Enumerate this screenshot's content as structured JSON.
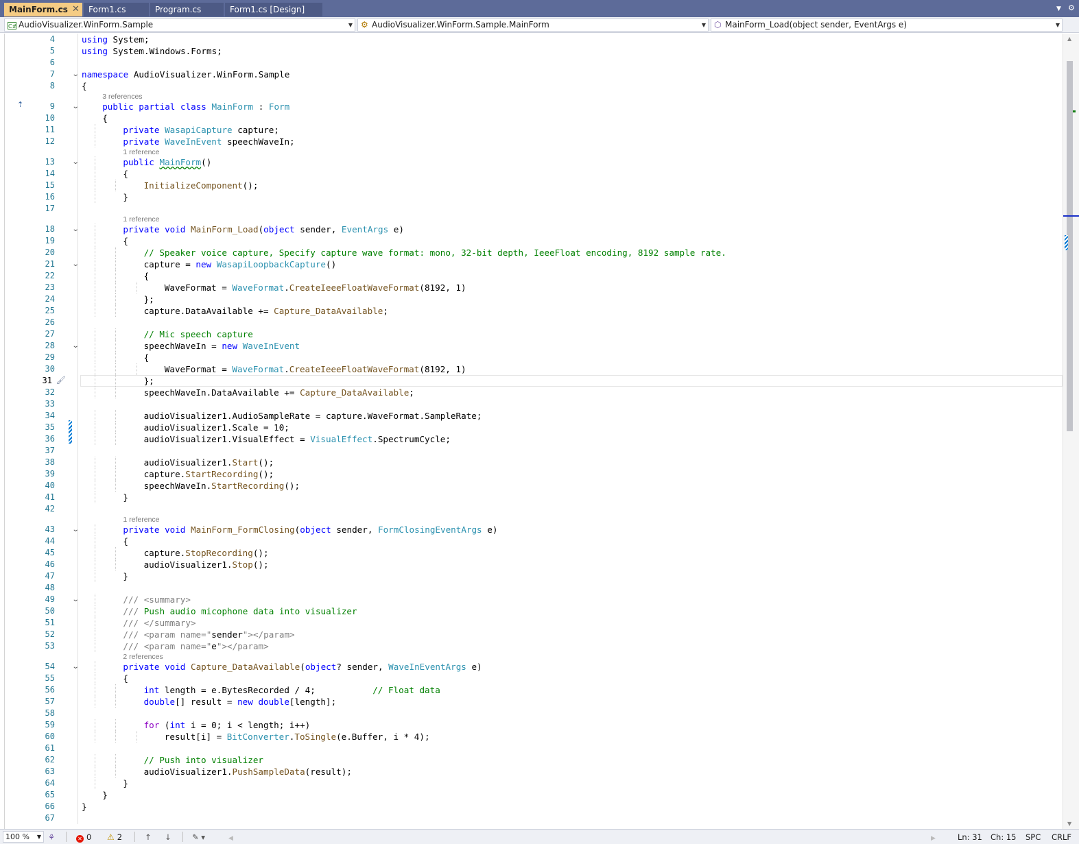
{
  "tabs": [
    {
      "label": "MainForm.cs",
      "active": true,
      "pin_icon": "pin-icon",
      "close_icon": "close-icon"
    },
    {
      "label": "Form1.cs",
      "active": false
    },
    {
      "label": "Program.cs",
      "active": false
    },
    {
      "label": "Form1.cs [Design]",
      "active": false
    }
  ],
  "nav": {
    "project": "AudioVisualizer.WinForm.Sample",
    "type": "AudioVisualizer.WinForm.Sample.MainForm",
    "member": "MainForm_Load(object sender, EventArgs e)"
  },
  "colors": {
    "keyword": "#0000ff",
    "type": "#2b91af",
    "method": "#74531f",
    "comment": "#008000",
    "line_number": "#237893",
    "tab_active": "#f5cc84",
    "tab_bar": "#5d6b99"
  },
  "current_line": 31,
  "code_lines": [
    {
      "n": 4,
      "indent": 0,
      "parts": [
        [
          "k",
          "using"
        ],
        [
          "",
          "System;"
        ]
      ],
      "guides": 0
    },
    {
      "n": 5,
      "indent": 0,
      "parts": [
        [
          "k",
          "using"
        ],
        [
          "",
          "System.Windows.Forms;"
        ]
      ]
    },
    {
      "n": 6,
      "indent": 0,
      "parts": []
    },
    {
      "n": 7,
      "indent": 0,
      "fold": true,
      "parts": [
        [
          "k",
          "namespace"
        ],
        [
          "",
          " AudioVisualizer.WinForm.Sample"
        ]
      ]
    },
    {
      "n": 8,
      "indent": 0,
      "parts": [
        [
          "",
          "{"
        ]
      ]
    },
    {
      "n": 9,
      "indent": 1,
      "fold": true,
      "lens": "3 references",
      "parts": [
        [
          "k",
          "public"
        ],
        [
          "",
          " "
        ],
        [
          "k",
          "partial"
        ],
        [
          "",
          " "
        ],
        [
          "k",
          "class"
        ],
        [
          "",
          " "
        ],
        [
          "t",
          "MainForm"
        ],
        [
          "",
          " : "
        ],
        [
          "t",
          "Form"
        ]
      ]
    },
    {
      "n": 10,
      "indent": 1,
      "parts": [
        [
          "",
          "{"
        ]
      ]
    },
    {
      "n": 11,
      "indent": 2,
      "parts": [
        [
          "k",
          "private"
        ],
        [
          "",
          " "
        ],
        [
          "t",
          "WasapiCapture"
        ],
        [
          "",
          " capture;"
        ]
      ]
    },
    {
      "n": 12,
      "indent": 2,
      "parts": [
        [
          "k",
          "private"
        ],
        [
          "",
          " "
        ],
        [
          "t",
          "WaveInEvent"
        ],
        [
          "",
          " speechWaveIn;"
        ]
      ]
    },
    {
      "n": 13,
      "indent": 2,
      "fold": true,
      "lens": "1 reference",
      "parts": [
        [
          "k",
          "public"
        ],
        [
          "",
          " "
        ],
        [
          "tsq",
          "MainForm"
        ],
        [
          "",
          "()"
        ]
      ]
    },
    {
      "n": 14,
      "indent": 2,
      "parts": [
        [
          "",
          "{"
        ]
      ]
    },
    {
      "n": 15,
      "indent": 3,
      "parts": [
        [
          "m",
          "InitializeComponent"
        ],
        [
          "",
          "();"
        ]
      ]
    },
    {
      "n": 16,
      "indent": 2,
      "parts": [
        [
          "",
          "}"
        ]
      ]
    },
    {
      "n": 17,
      "indent": 0,
      "parts": []
    },
    {
      "n": 18,
      "indent": 2,
      "fold": true,
      "lens": "1 reference",
      "parts": [
        [
          "k",
          "private"
        ],
        [
          "",
          " "
        ],
        [
          "k",
          "void"
        ],
        [
          "",
          " "
        ],
        [
          "m",
          "MainForm_Load"
        ],
        [
          "",
          "("
        ],
        [
          "k",
          "object"
        ],
        [
          "",
          " sender, "
        ],
        [
          "t",
          "EventArgs"
        ],
        [
          "",
          " e)"
        ]
      ]
    },
    {
      "n": 19,
      "indent": 2,
      "parts": [
        [
          "",
          "{"
        ]
      ]
    },
    {
      "n": 20,
      "indent": 3,
      "parts": [
        [
          "c",
          "// Speaker voice capture, Specify capture wave format: mono, 32-bit depth, IeeeFloat encoding, 8192 sample rate."
        ]
      ]
    },
    {
      "n": 21,
      "indent": 3,
      "fold": true,
      "parts": [
        [
          "",
          "capture = "
        ],
        [
          "k",
          "new"
        ],
        [
          "",
          " "
        ],
        [
          "t",
          "WasapiLoopbackCapture"
        ],
        [
          "",
          "()"
        ]
      ]
    },
    {
      "n": 22,
      "indent": 3,
      "parts": [
        [
          "",
          "{"
        ]
      ]
    },
    {
      "n": 23,
      "indent": 4,
      "parts": [
        [
          "",
          "WaveFormat = "
        ],
        [
          "t",
          "WaveFormat"
        ],
        [
          "",
          "."
        ],
        [
          "m",
          "CreateIeeeFloatWaveFormat"
        ],
        [
          "",
          "(8192, 1)"
        ]
      ]
    },
    {
      "n": 24,
      "indent": 3,
      "parts": [
        [
          "",
          "};"
        ]
      ]
    },
    {
      "n": 25,
      "indent": 3,
      "parts": [
        [
          "",
          "capture.DataAvailable += "
        ],
        [
          "m",
          "Capture_DataAvailable"
        ],
        [
          "",
          ";"
        ]
      ]
    },
    {
      "n": 26,
      "indent": 0,
      "parts": []
    },
    {
      "n": 27,
      "indent": 3,
      "parts": [
        [
          "c",
          "// Mic speech capture"
        ]
      ]
    },
    {
      "n": 28,
      "indent": 3,
      "fold": true,
      "parts": [
        [
          "",
          "speechWaveIn = "
        ],
        [
          "k",
          "new"
        ],
        [
          "",
          " "
        ],
        [
          "t",
          "WaveInEvent"
        ]
      ]
    },
    {
      "n": 29,
      "indent": 3,
      "parts": [
        [
          "",
          "{"
        ]
      ]
    },
    {
      "n": 30,
      "indent": 4,
      "parts": [
        [
          "",
          "WaveFormat = "
        ],
        [
          "t",
          "WaveFormat"
        ],
        [
          "",
          "."
        ],
        [
          "m",
          "CreateIeeeFloatWaveFormat"
        ],
        [
          "",
          "(8192, 1)"
        ]
      ]
    },
    {
      "n": 31,
      "indent": 3,
      "parts": [
        [
          "",
          "};"
        ]
      ]
    },
    {
      "n": 32,
      "indent": 3,
      "parts": [
        [
          "",
          "speechWaveIn.DataAvailable += "
        ],
        [
          "m",
          "Capture_DataAvailable"
        ],
        [
          "",
          ";"
        ]
      ]
    },
    {
      "n": 33,
      "indent": 0,
      "parts": []
    },
    {
      "n": 34,
      "indent": 3,
      "parts": [
        [
          "",
          "audioVisualizer1.AudioSampleRate = capture.WaveFormat.SampleRate;"
        ]
      ]
    },
    {
      "n": 35,
      "indent": 3,
      "parts": [
        [
          "",
          "audioVisualizer1.Scale = 10;"
        ]
      ]
    },
    {
      "n": 36,
      "indent": 3,
      "parts": [
        [
          "",
          "audioVisualizer1.VisualEffect = "
        ],
        [
          "t",
          "VisualEffect"
        ],
        [
          "",
          ".SpectrumCycle;"
        ]
      ]
    },
    {
      "n": 37,
      "indent": 0,
      "parts": []
    },
    {
      "n": 38,
      "indent": 3,
      "parts": [
        [
          "",
          "audioVisualizer1."
        ],
        [
          "m",
          "Start"
        ],
        [
          "",
          "();"
        ]
      ]
    },
    {
      "n": 39,
      "indent": 3,
      "parts": [
        [
          "",
          "capture."
        ],
        [
          "m",
          "StartRecording"
        ],
        [
          "",
          "();"
        ]
      ]
    },
    {
      "n": 40,
      "indent": 3,
      "parts": [
        [
          "",
          "speechWaveIn."
        ],
        [
          "m",
          "StartRecording"
        ],
        [
          "",
          "();"
        ]
      ]
    },
    {
      "n": 41,
      "indent": 2,
      "parts": [
        [
          "",
          "}"
        ]
      ]
    },
    {
      "n": 42,
      "indent": 0,
      "parts": []
    },
    {
      "n": 43,
      "indent": 2,
      "fold": true,
      "lens": "1 reference",
      "parts": [
        [
          "k",
          "private"
        ],
        [
          "",
          " "
        ],
        [
          "k",
          "void"
        ],
        [
          "",
          " "
        ],
        [
          "m",
          "MainForm_FormClosing"
        ],
        [
          "",
          "("
        ],
        [
          "k",
          "object"
        ],
        [
          "",
          " sender, "
        ],
        [
          "t",
          "FormClosingEventArgs"
        ],
        [
          "",
          " e)"
        ]
      ]
    },
    {
      "n": 44,
      "indent": 2,
      "parts": [
        [
          "",
          "{"
        ]
      ]
    },
    {
      "n": 45,
      "indent": 3,
      "parts": [
        [
          "",
          "capture."
        ],
        [
          "m",
          "StopRecording"
        ],
        [
          "",
          "();"
        ]
      ]
    },
    {
      "n": 46,
      "indent": 3,
      "parts": [
        [
          "",
          "audioVisualizer1."
        ],
        [
          "m",
          "Stop"
        ],
        [
          "",
          "();"
        ]
      ]
    },
    {
      "n": 47,
      "indent": 2,
      "parts": [
        [
          "",
          "}"
        ]
      ]
    },
    {
      "n": 48,
      "indent": 0,
      "parts": []
    },
    {
      "n": 49,
      "indent": 2,
      "fold": true,
      "parts": [
        [
          "cx",
          "/// <summary>"
        ]
      ]
    },
    {
      "n": 50,
      "indent": 2,
      "parts": [
        [
          "cx",
          "/// "
        ],
        [
          "c",
          "Push audio micophone data into visualizer"
        ]
      ]
    },
    {
      "n": 51,
      "indent": 2,
      "parts": [
        [
          "cx",
          "/// </summary>"
        ]
      ]
    },
    {
      "n": 52,
      "indent": 2,
      "parts": [
        [
          "cx",
          "/// <param name=\""
        ],
        [
          "",
          "sender"
        ],
        [
          "cx",
          "\"></param>"
        ]
      ]
    },
    {
      "n": 53,
      "indent": 2,
      "parts": [
        [
          "cx",
          "/// <param name=\""
        ],
        [
          "",
          "e"
        ],
        [
          "cx",
          "\"></param>"
        ]
      ]
    },
    {
      "n": 54,
      "indent": 2,
      "fold": true,
      "lens": "2 references",
      "parts": [
        [
          "k",
          "private"
        ],
        [
          "",
          " "
        ],
        [
          "k",
          "void"
        ],
        [
          "",
          " "
        ],
        [
          "m",
          "Capture_DataAvailable"
        ],
        [
          "",
          "("
        ],
        [
          "k",
          "object"
        ],
        [
          "",
          "? sender, "
        ],
        [
          "t",
          "WaveInEventArgs"
        ],
        [
          "",
          " e)"
        ]
      ]
    },
    {
      "n": 55,
      "indent": 2,
      "parts": [
        [
          "",
          "{"
        ]
      ]
    },
    {
      "n": 56,
      "indent": 3,
      "parts": [
        [
          "k",
          "int"
        ],
        [
          "",
          " length = e.BytesRecorded / 4;           "
        ],
        [
          "c",
          "// Float data"
        ]
      ]
    },
    {
      "n": 57,
      "indent": 3,
      "parts": [
        [
          "k",
          "double"
        ],
        [
          "",
          "[] result = "
        ],
        [
          "k",
          "new"
        ],
        [
          "",
          " "
        ],
        [
          "k",
          "double"
        ],
        [
          "",
          "[length];"
        ]
      ]
    },
    {
      "n": 58,
      "indent": 0,
      "parts": []
    },
    {
      "n": 59,
      "indent": 3,
      "parts": [
        [
          "kc",
          "for"
        ],
        [
          "",
          " ("
        ],
        [
          "k",
          "int"
        ],
        [
          "",
          " i = 0; i < length; i++)"
        ]
      ]
    },
    {
      "n": 60,
      "indent": 4,
      "parts": [
        [
          "",
          "result[i] = "
        ],
        [
          "t",
          "BitConverter"
        ],
        [
          "",
          "."
        ],
        [
          "m",
          "ToSingle"
        ],
        [
          "",
          "(e.Buffer, i * 4);"
        ]
      ]
    },
    {
      "n": 61,
      "indent": 0,
      "parts": []
    },
    {
      "n": 62,
      "indent": 3,
      "parts": [
        [
          "c",
          "// Push into visualizer"
        ]
      ]
    },
    {
      "n": 63,
      "indent": 3,
      "parts": [
        [
          "",
          "audioVisualizer1."
        ],
        [
          "m",
          "PushSampleData"
        ],
        [
          "",
          "(result);"
        ]
      ]
    },
    {
      "n": 64,
      "indent": 2,
      "parts": [
        [
          "",
          "}"
        ]
      ]
    },
    {
      "n": 65,
      "indent": 1,
      "parts": [
        [
          "",
          "}"
        ]
      ]
    },
    {
      "n": 66,
      "indent": 0,
      "parts": [
        [
          "",
          "}"
        ]
      ]
    },
    {
      "n": 67,
      "indent": 0,
      "parts": []
    }
  ],
  "status": {
    "zoom": "100 %",
    "errors": "0",
    "warnings": "2",
    "line": "Ln: 31",
    "col": "Ch: 15",
    "indent_mode": "SPC",
    "line_ending": "CRLF"
  }
}
